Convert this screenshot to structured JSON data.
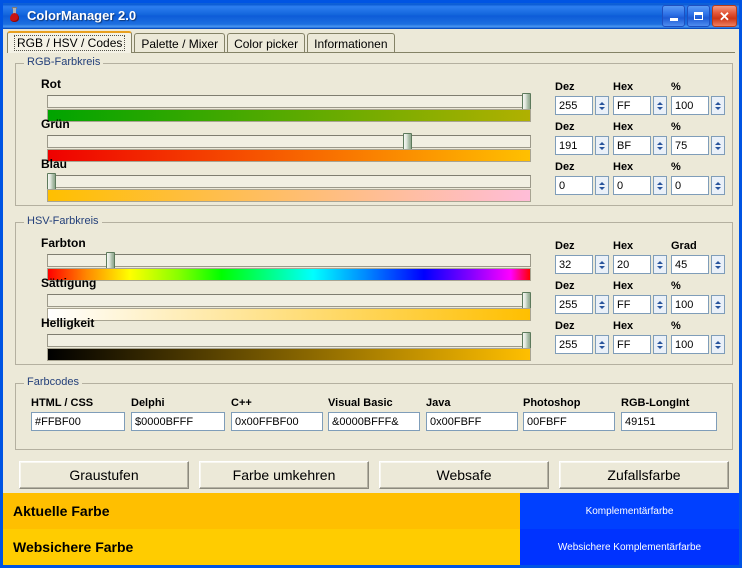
{
  "window": {
    "title": "ColorManager 2.0",
    "icon": "flask-icon",
    "minimize": "–",
    "maximize": "□",
    "close": "✕",
    "titlebar_color": "#0a5bd4"
  },
  "tabs": [
    {
      "label": "RGB / HSV / Codes",
      "active": true
    },
    {
      "label": "Palette / Mixer",
      "active": false
    },
    {
      "label": "Color picker",
      "active": false
    },
    {
      "label": "Informationen",
      "active": false
    }
  ],
  "rgb_group": {
    "legend": "RGB-Farbkreis",
    "channels": [
      {
        "label": "Rot",
        "dez_header": "Dez",
        "hex_header": "Hex",
        "pct_header": "%",
        "dez": "255",
        "hex": "FF",
        "pct": "100",
        "thumb_pct": 100,
        "bar_from": "#00a400",
        "bar_to": "#b0b000"
      },
      {
        "label": "Grün",
        "dez_header": "Dez",
        "hex_header": "Hex",
        "pct_header": "%",
        "dez": "191",
        "hex": "BF",
        "pct": "75",
        "thumb_pct": 75,
        "bar_from": "#ef0000",
        "bar_to": "#ffc000"
      },
      {
        "label": "Blau",
        "dez_header": "Dez",
        "hex_header": "Hex",
        "pct_header": "%",
        "dez": "0",
        "hex": "0",
        "pct": "0",
        "thumb_pct": 0,
        "bar_from": "#ffbf00",
        "bar_to": "#ffbdd8"
      }
    ]
  },
  "hsv_group": {
    "legend": "HSV-Farbkreis",
    "channels": [
      {
        "label": "Farbton",
        "dez_header": "Dez",
        "hex_header": "Hex",
        "pct_header": "Grad",
        "dez": "32",
        "hex": "20",
        "pct": "45",
        "thumb_pct": 12.5,
        "bar_type": "hue"
      },
      {
        "label": "Sättigung",
        "dez_header": "Dez",
        "hex_header": "Hex",
        "pct_header": "%",
        "dez": "255",
        "hex": "FF",
        "pct": "100",
        "thumb_pct": 100,
        "bar_from": "#ffffff",
        "bar_to": "#ffbf00"
      },
      {
        "label": "Helligkeit",
        "dez_header": "Dez",
        "hex_header": "Hex",
        "pct_header": "%",
        "dez": "255",
        "hex": "FF",
        "pct": "100",
        "thumb_pct": 100,
        "bar_from": "#000000",
        "bar_to": "#ffbf00"
      }
    ]
  },
  "farbcodes": {
    "legend": "Farbcodes",
    "fields": [
      {
        "label": "HTML / CSS",
        "value": "#FFBF00"
      },
      {
        "label": "Delphi",
        "value": "$0000BFFF"
      },
      {
        "label": "C++",
        "value": "0x00FFBF00"
      },
      {
        "label": "Visual Basic",
        "value": "&0000BFFF&"
      },
      {
        "label": "Java",
        "value": "0x00FBFF"
      },
      {
        "label": "Photoshop",
        "value": "00FBFF"
      },
      {
        "label": "RGB-LongInt",
        "value": "49151"
      }
    ]
  },
  "actions": [
    {
      "label": "Graustufen"
    },
    {
      "label": "Farbe umkehren"
    },
    {
      "label": "Websafe"
    },
    {
      "label": "Zufallsfarbe"
    }
  ],
  "preview": {
    "current_label": "Aktuelle Farbe",
    "websafe_label": "Websichere Farbe",
    "complement_label": "Komplementärfarbe",
    "websafe_complement_label": "Websichere Komplementärfarbe",
    "current_color": "#FFBF00",
    "websafe_color": "#FFCC00",
    "complement_color": "#0040FF",
    "websafe_complement_color": "#0033FF"
  }
}
